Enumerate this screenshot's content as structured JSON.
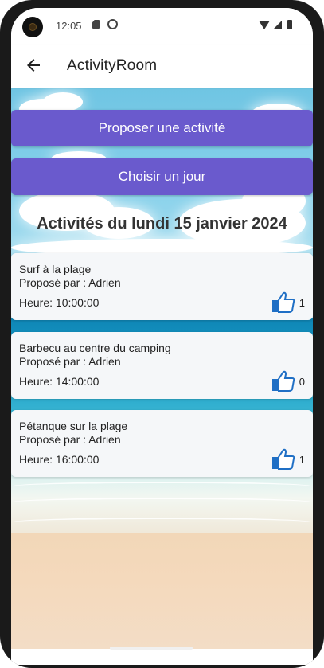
{
  "status_bar": {
    "time": "12:05"
  },
  "app_bar": {
    "back_icon": "arrow-left-icon",
    "title": "ActivityRoom"
  },
  "buttons": {
    "propose_label": "Proposer une activité",
    "choose_day_label": "Choisir un jour"
  },
  "colors": {
    "accent": "#6a5acd",
    "like_icon": "#1f6fc5"
  },
  "section": {
    "title": "Activités du lundi 15 janvier 2024"
  },
  "activities": [
    {
      "name": "Surf à la plage",
      "author": "Proposé par : Adrien",
      "time": "Heure: 10:00:00",
      "likes": "1"
    },
    {
      "name": "Barbecu au centre du camping",
      "author": "Proposé par : Adrien",
      "time": "Heure: 14:00:00",
      "likes": "0"
    },
    {
      "name": "Pétanque sur la plage",
      "author": "Proposé par : Adrien",
      "time": "Heure: 16:00:00",
      "likes": "1"
    }
  ]
}
